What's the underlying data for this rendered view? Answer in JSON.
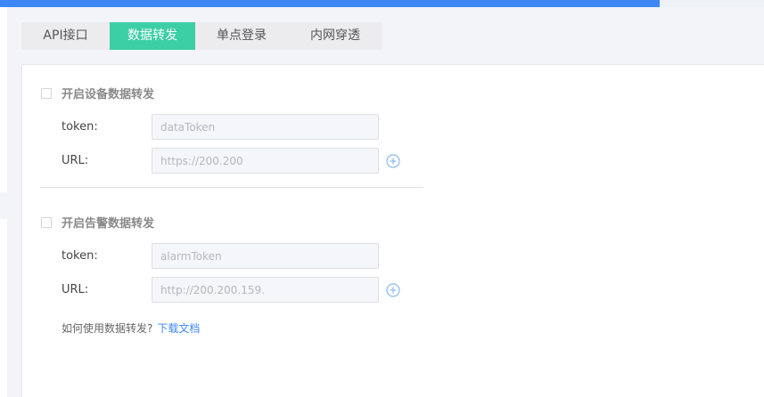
{
  "tabs": [
    {
      "label": "API接口",
      "active": false
    },
    {
      "label": "数据转发",
      "active": true
    },
    {
      "label": "单点登录",
      "active": false
    },
    {
      "label": "内网穿透",
      "active": false
    }
  ],
  "device_forward": {
    "title": "开启设备数据转发",
    "checked": false,
    "token_label": "token:",
    "token_placeholder": "dataToken",
    "url_label": "URL:",
    "url_placeholder": "https://200.200"
  },
  "alarm_forward": {
    "title": "开启告警数据转发",
    "checked": false,
    "token_label": "token:",
    "token_placeholder": "alarmToken",
    "url_label": "URL:",
    "url_placeholder": "http://200.200.159."
  },
  "help": {
    "text": "如何使用数据转发?",
    "link": "下载文档"
  },
  "colors": {
    "accent": "#3ccfa6",
    "brand_blue": "#3d87f6",
    "icon_blue": "#8ab8f0"
  }
}
